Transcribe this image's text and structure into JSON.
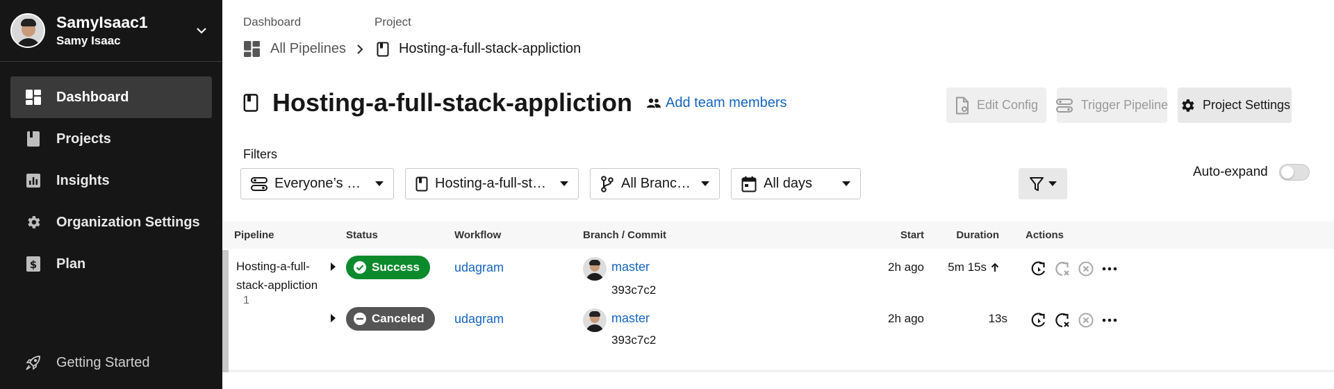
{
  "sidebar": {
    "user": {
      "handle": "SamyIsaac1",
      "name": "Samy Isaac"
    },
    "items": [
      {
        "label": "Dashboard",
        "icon": "dashboard-icon",
        "active": true
      },
      {
        "label": "Projects",
        "icon": "book-icon"
      },
      {
        "label": "Insights",
        "icon": "insights-icon"
      },
      {
        "label": "Organization Settings",
        "icon": "gear-icon"
      },
      {
        "label": "Plan",
        "icon": "dollar-icon"
      }
    ],
    "getting_started": "Getting Started"
  },
  "breadcrumb": {
    "top_dashboard": "Dashboard",
    "top_project": "Project",
    "all_pipelines": "All Pipelines",
    "project": "Hosting-a-full-stack-appliction"
  },
  "header": {
    "title": "Hosting-a-full-stack-appliction",
    "add_team": "Add team members",
    "edit_config": "Edit Config",
    "trigger_pipeline": "Trigger Pipeline",
    "project_settings": "Project Settings"
  },
  "filters": {
    "label": "Filters",
    "pipelines": "Everyone’s Pipelines",
    "project": "Hosting-a-full-stack-a...",
    "branches": "All Branches",
    "days": "All days",
    "auto_expand": "Auto-expand",
    "auto_expand_on": false
  },
  "table": {
    "columns": {
      "pipeline": "Pipeline",
      "status": "Status",
      "workflow": "Workflow",
      "branch_commit": "Branch / Commit",
      "start": "Start",
      "duration": "Duration",
      "actions": "Actions"
    },
    "pipeline": {
      "name": "Hosting-a-full-stack-appliction",
      "number": "1",
      "workflows": [
        {
          "status": "Success",
          "status_color": "#0d8a2c",
          "workflow": "udagram",
          "branch": "master",
          "commit": "393c7c2",
          "start": "2h ago",
          "duration": "5m 15s"
        },
        {
          "status": "Canceled",
          "status_color": "#555555",
          "workflow": "udagram",
          "branch": "master",
          "commit": "393c7c2",
          "start": "2h ago",
          "duration": "13s"
        }
      ]
    }
  },
  "colors": {
    "sidebar_bg": "#161616",
    "link": "#1565c0",
    "success": "#0d8a2c",
    "canceled": "#555555"
  }
}
